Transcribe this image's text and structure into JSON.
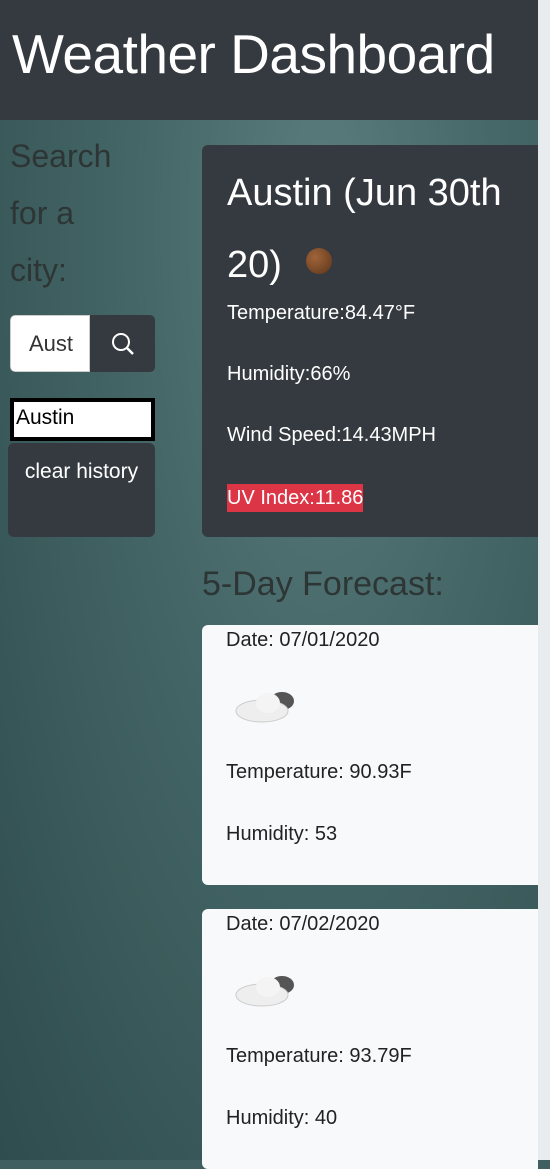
{
  "header": {
    "title": "Weather Dashboard"
  },
  "search": {
    "label": "Search for a city:",
    "value": "Aust",
    "icon": "search-icon"
  },
  "history": {
    "items": [
      "Austin"
    ],
    "clear_label": "clear history"
  },
  "current": {
    "city_date": "Austin (Jun 30th 20)",
    "icon": "moon-icon",
    "temperature": "Temperature:84.47°F",
    "humidity": "Humidity:66%",
    "wind": "Wind Speed:14.43MPH",
    "uv": "UV Index:11.86",
    "uv_color": "#dc3545"
  },
  "forecast": {
    "heading": "5-Day Forecast:",
    "days": [
      {
        "date": "Date: 07/01/2020",
        "icon": "cloud-icon",
        "temperature": "Temperature: 90.93F",
        "humidity": "Humidity: 53"
      },
      {
        "date": "Date: 07/02/2020",
        "icon": "cloud-icon",
        "temperature": "Temperature: 93.79F",
        "humidity": "Humidity: 40"
      }
    ]
  }
}
